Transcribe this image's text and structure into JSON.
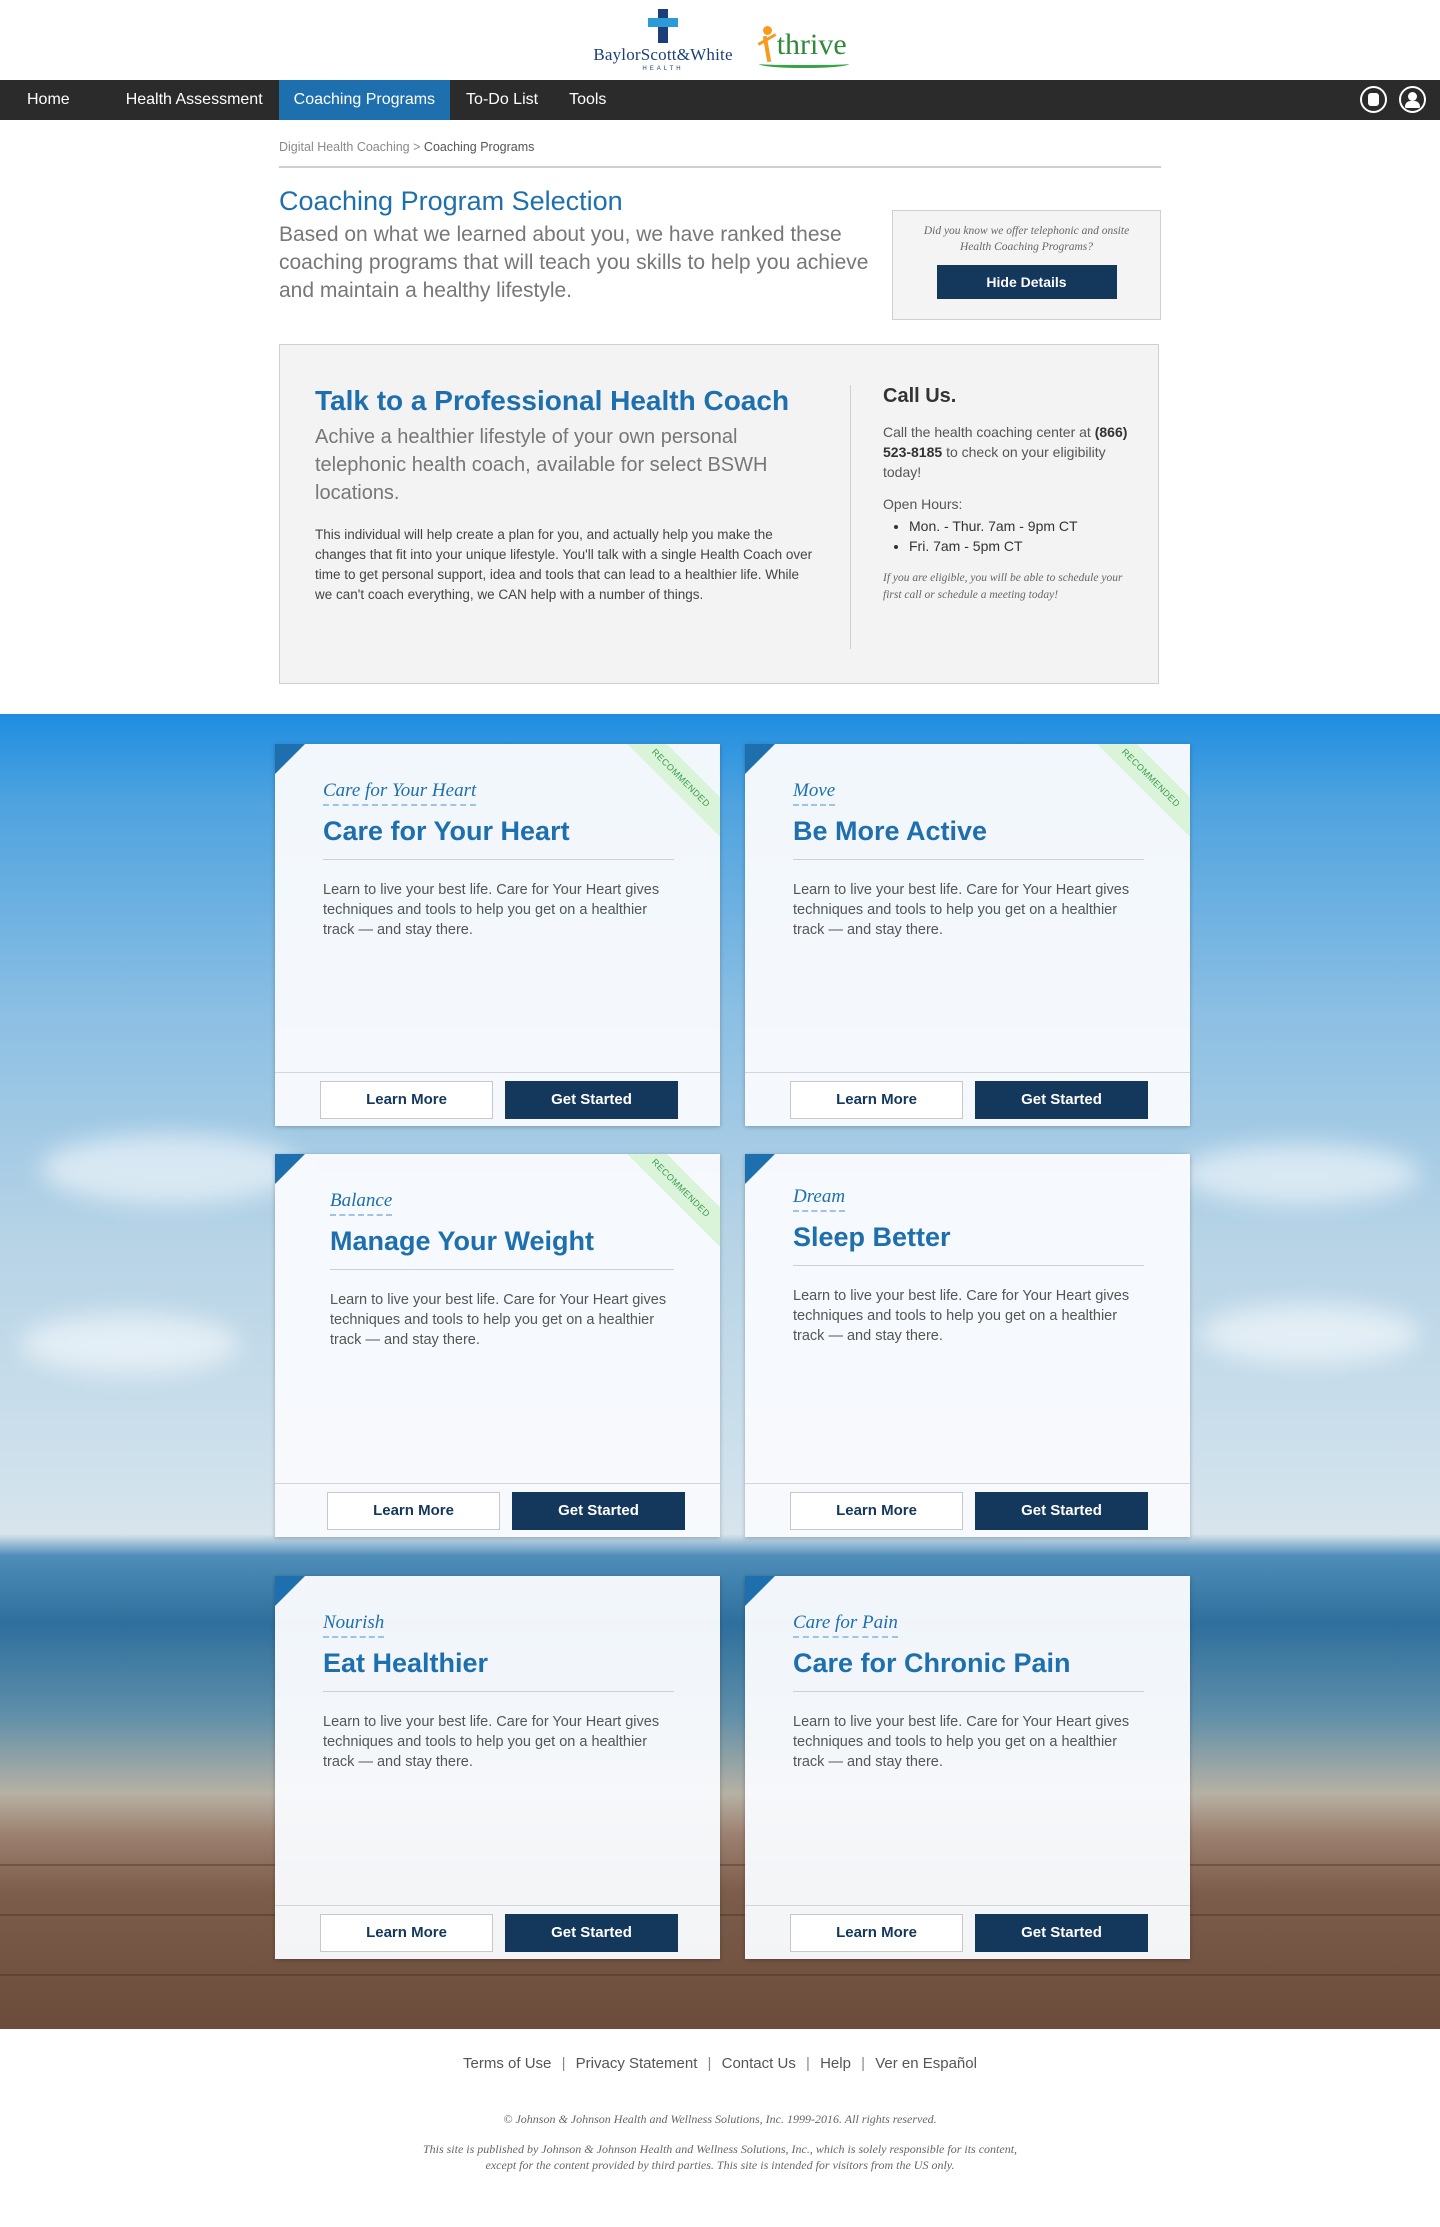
{
  "logos": {
    "bsw_name": "BaylorScott&White",
    "bsw_sub": "HEALTH",
    "thrive_name": "thrive"
  },
  "nav": {
    "items": [
      {
        "label": "Home"
      },
      {
        "label": "Health Assessment"
      },
      {
        "label": "Coaching Programs"
      },
      {
        "label": "To-Do List"
      },
      {
        "label": "Tools"
      }
    ],
    "active_index": 2,
    "right_icons": [
      "accessibility-icon",
      "user-account-icon"
    ]
  },
  "breadcrumb": {
    "parent": "Digital Health Coaching",
    "separator": ">",
    "current": "Coaching Programs"
  },
  "selection": {
    "title": "Coaching Program Selection",
    "description": "Based on what we learned about you, we have ranked these coaching programs that will teach you skills to help you achieve and maintain a healthy lifestyle.",
    "info_text": "Did you know we offer telephonic and onsite Health Coaching Programs?",
    "hide_details_label": "Hide Details"
  },
  "coach": {
    "title": "Talk to a Professional Health Coach",
    "subtitle": "Achive a healthier lifestyle  of your own personal telephonic health coach, available for select BSWH locations.",
    "body": "This individual will help create a plan for you, and actually help you make the changes that fit into your unique lifestyle.  You'll talk with a single Health Coach over time to get personal support, idea and tools that can lead to a healthier life.  While we can't coach everything, we CAN help with a number of things.",
    "call_title": "Call Us.",
    "call_text_before": "Call the health coaching center at",
    "call_phone": "(866) 523-8185",
    "call_text_after": "to check on your eligibility today!",
    "hours_label": "Open Hours:",
    "hours": [
      "Mon. - Thur. 7am - 9pm CT",
      "Fri. 7am - 5pm CT"
    ],
    "note": "If you are eligible, you will be able to schedule your first call or schedule a meeting today!"
  },
  "programs": [
    {
      "category": "Care for Your Heart",
      "title": "Care for Your Heart",
      "desc": "Learn to live your best life. Care for Your Heart gives techniques and tools to help you get on a healthier track — and stay there.",
      "recommended": true
    },
    {
      "category": "Move",
      "title": "Be More Active",
      "desc": "Learn to live your best life. Care for Your Heart gives techniques and tools to help you get on a healthier track — and stay there.",
      "recommended": true
    },
    {
      "category": "Balance",
      "title": "Manage Your Weight",
      "desc": "Learn to live your best life. Care for Your Heart gives techniques and tools to help you get on a healthier track — and stay there.",
      "recommended": true
    },
    {
      "category": "Dream",
      "title": "Sleep Better",
      "desc": "Learn to live your best life. Care for Your Heart gives techniques and tools to help you get on a healthier track — and stay there.",
      "recommended": false
    },
    {
      "category": "Nourish",
      "title": "Eat Healthier",
      "desc": "Learn to live your best life. Care for Your Heart gives techniques and tools to help you get on a healthier track — and stay there.",
      "recommended": false
    },
    {
      "category": "Care for Pain",
      "title": "Care for Chronic Pain",
      "desc": "Learn to live your best life. Care for Your Heart gives techniques and tools to help you get on a healthier track — and stay there.",
      "recommended": false
    }
  ],
  "card_labels": {
    "recommended": "RECOMMENDED",
    "learn_more": "Learn More",
    "get_started": "Get Started"
  },
  "footer": {
    "links": [
      "Terms of Use",
      "Privacy Statement",
      "Contact Us",
      "Help",
      "Ver en Español"
    ],
    "separator": "|",
    "copyright": "© Johnson & Johnson Health and Wellness Solutions, Inc. 1999-2016. All rights reserved.",
    "note": "This site is published by Johnson & Johnson Health and Wellness Solutions, Inc., which is solely responsible for its content, except for the content provided by third parties.  This site is intended for visitors from the US only."
  },
  "colors": {
    "brand_blue": "#1e6fae",
    "dark_navy": "#14375c",
    "nav_bg": "#2b2b2b",
    "recommended_green": "#3d9a4d"
  }
}
